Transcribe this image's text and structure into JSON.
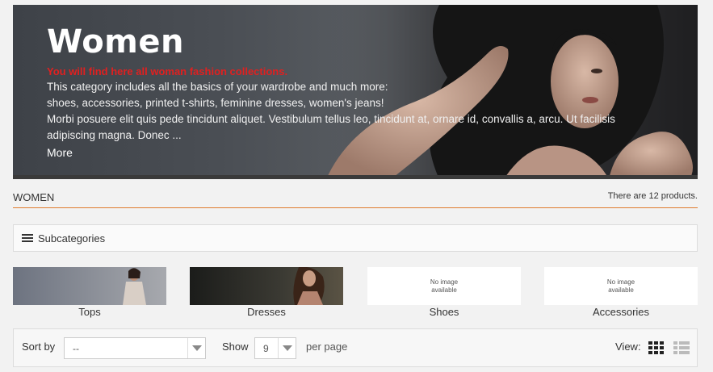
{
  "banner": {
    "title": "Women",
    "tagline": "You will find here all woman fashion collections.",
    "desc_line1": "This category includes all the basics of your wardrobe and much more:",
    "desc_line2": "shoes, accessories, printed t-shirts, feminine dresses, women's jeans!",
    "desc_line3": "Morbi posuere elit quis pede tincidunt aliquet. Vestibulum tellus leo, tincidunt at, ornare id, convallis a, arcu. Ut facilisis",
    "desc_line4": "adipiscing magna. Donec ...",
    "more_link": "More"
  },
  "category": {
    "name": "WOMEN",
    "product_count": "There are 12 products."
  },
  "subcategories": {
    "heading": "Subcategories",
    "items": [
      {
        "label": "Tops",
        "image": "photo"
      },
      {
        "label": "Dresses",
        "image": "photo"
      },
      {
        "label": "Shoes",
        "image": "none",
        "no_image_line1": "No image",
        "no_image_line2": "available"
      },
      {
        "label": "Accessories",
        "image": "none",
        "no_image_line1": "No image",
        "no_image_line2": "available"
      }
    ]
  },
  "toolbar": {
    "sort_label": "Sort by",
    "sort_value": "--",
    "show_label": "Show",
    "show_value": "9",
    "per_page_label": "per page",
    "view_label": "View:",
    "view_icons": [
      "grid-icon",
      "list-icon"
    ],
    "active_view": "grid"
  },
  "colors": {
    "accent": "#e07c2e",
    "tagline": "#e02020",
    "background": "#f2f2f2"
  }
}
